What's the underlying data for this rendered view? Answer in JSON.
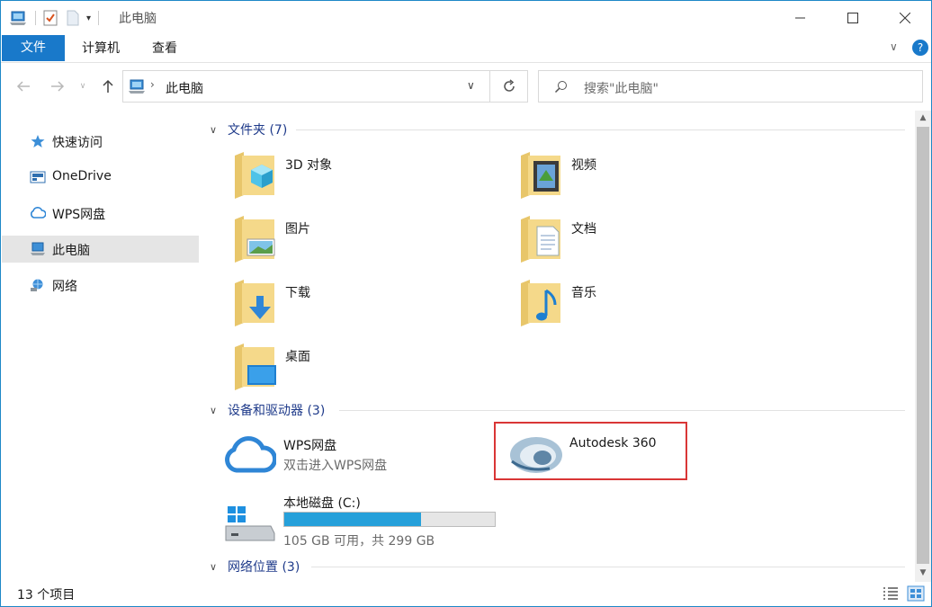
{
  "window": {
    "title": "此电脑"
  },
  "ribbon": {
    "tabs": [
      "文件",
      "计算机",
      "查看"
    ]
  },
  "address": {
    "path_item": "此电脑",
    "search_placeholder": "搜索\"此电脑\""
  },
  "sidebar": {
    "items": [
      {
        "label": "快速访问",
        "icon": "star-icon"
      },
      {
        "label": "OneDrive",
        "icon": "onedrive-icon"
      },
      {
        "label": "WPS网盘",
        "icon": "cloud-icon"
      },
      {
        "label": "此电脑",
        "icon": "computer-icon"
      },
      {
        "label": "网络",
        "icon": "network-icon"
      }
    ]
  },
  "groups": {
    "folders": "文件夹 (7)",
    "devices": "设备和驱动器 (3)",
    "network": "网络位置 (3)"
  },
  "folders": [
    "3D 对象",
    "视频",
    "图片",
    "文档",
    "下载",
    "音乐",
    "桌面"
  ],
  "devices": {
    "wps": {
      "title": "WPS网盘",
      "subtitle": "双击进入WPS网盘"
    },
    "autodesk": {
      "title": "Autodesk 360"
    },
    "local_disk": {
      "title": "本地磁盘 (C:)",
      "subtitle": "105 GB 可用，共 299 GB",
      "used_fraction": 0.649
    }
  },
  "status": {
    "count": "13 个项目"
  },
  "colors": {
    "accent": "#1979ca",
    "disk_fill": "#26a0da",
    "highlight": "#d93636"
  }
}
